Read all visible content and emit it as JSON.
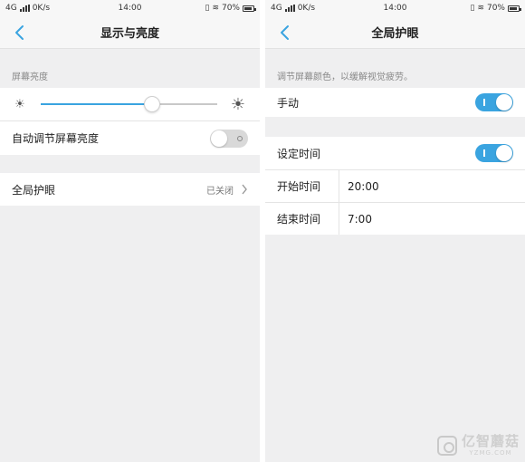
{
  "status": {
    "network": "4G",
    "speed": "0K/s",
    "time": "14:00",
    "battery": "70%"
  },
  "left": {
    "title": "显示与亮度",
    "brightness_label": "屏幕亮度",
    "brightness_level": 0.63,
    "auto_brightness_label": "自动调节屏幕亮度",
    "auto_brightness_on": false,
    "eye_care_label": "全局护眼",
    "eye_care_status": "已关闭"
  },
  "right": {
    "title": "全局护眼",
    "description": "调节屏幕颜色，以缓解视觉疲劳。",
    "manual_label": "手动",
    "manual_on": true,
    "schedule_label": "设定时间",
    "schedule_on": true,
    "start_label": "开始时间",
    "start_value": "20:00",
    "end_label": "结束时间",
    "end_value": "7:00"
  },
  "watermark": {
    "brand": "亿智蘑菇",
    "domain": "YZMG.COM"
  },
  "colors": {
    "accent": "#3aa4e0",
    "toggle_off": "#d9d9d9",
    "background": "#efeff0"
  }
}
